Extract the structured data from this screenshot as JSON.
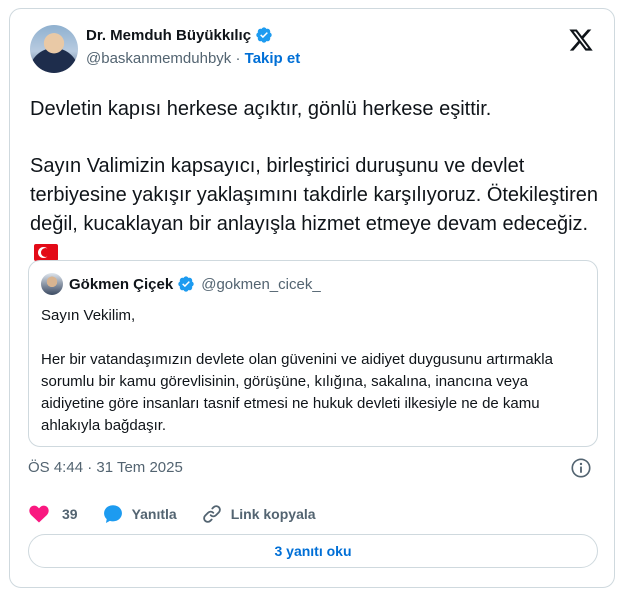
{
  "author": {
    "name": "Dr. Memduh Büyükkılıç",
    "handle": "@baskanmemduhbyk",
    "separator": "·",
    "follow_label": "Takip et"
  },
  "tweet": {
    "line1": "Devletin kapısı herkese açıktır, gönlü herkese eşittir.",
    "line2": "Sayın Valimizin kapsayıcı, birleştirici duruşunu ve devlet terbiyesine yakışır yaklaşımını takdirle karşılıyoruz. Ötekileştiren değil, kucaklayan bir anlayışla hizmet etmeye devam edeceğiz."
  },
  "quote": {
    "name": "Gökmen Çiçek",
    "handle": "@gokmen_cicek_",
    "greeting": "Sayın Vekilim,",
    "body": "Her bir vatandaşımızın devlete olan güvenini ve aidiyet duygusunu artırmakla sorumlu bir kamu görevlisinin, görüşüne, kılığına, sakalına, inancına veya aidiyetine göre insanları tasnif etmesi ne hukuk devleti ilkesiyle ne de kamu ahlakıyla bağdaşır."
  },
  "meta": {
    "timestamp": "ÖS 4:44 · 31 Tem 2025"
  },
  "actions": {
    "like_count": "39",
    "reply_label": "Yanıtla",
    "copy_link_label": "Link kopyala"
  },
  "replies_button": "3 yanıtı oku",
  "colors": {
    "accent": "#006fd6",
    "like": "#f91880",
    "reply": "#1d9bf0",
    "verified": "#1d9bf0",
    "border": "#cfd9de",
    "muted": "#536471"
  },
  "icons": [
    "verified-badge-icon",
    "x-logo-icon",
    "turkish-flag-icon",
    "info-icon",
    "heart-icon",
    "reply-bubble-icon",
    "link-icon"
  ]
}
